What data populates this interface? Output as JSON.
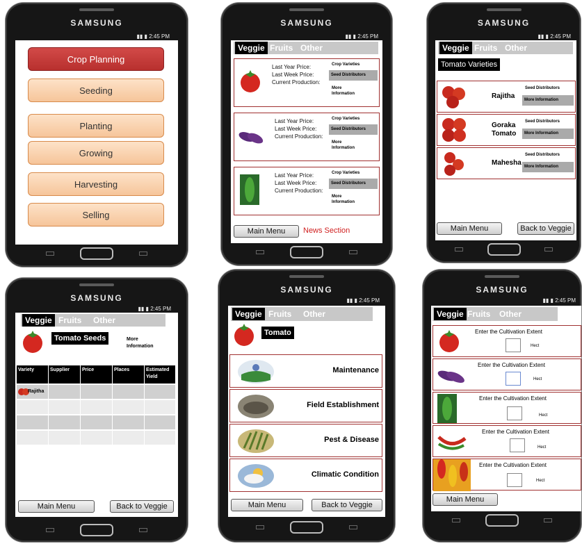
{
  "brand": "SAMSUNG",
  "status_time": "2:45 PM",
  "phone1": {
    "menu": [
      "Crop Planning",
      "Seeding",
      "Planting",
      "Growing",
      "Harvesting",
      "Selling"
    ]
  },
  "tabs": {
    "veggie": "Veggie",
    "fruits": "Fruits",
    "other": "Other"
  },
  "phone2": {
    "cards": [
      {
        "labels": [
          "Last Year Price:",
          "Last Week Price:",
          "Current Production:"
        ],
        "crop_varieties": "Crop Varieties",
        "seed_distributors": "Seed Distributors",
        "more_info": "More Information"
      },
      {
        "labels": [
          "Last Year Price:",
          "Last Week Price:",
          "Current Production:"
        ],
        "crop_varieties": "Crop Varieties",
        "seed_distributors": "Seed Distributors",
        "more_info": "More Information"
      },
      {
        "labels": [
          "Last Year Price:",
          "Last Week Price:",
          "Current Production:"
        ],
        "crop_varieties": "Crop Varieties",
        "seed_distributors": "Seed Distributors",
        "more_info": "More Information"
      }
    ],
    "main_menu": "Main Menu",
    "news_section": "News Section"
  },
  "phone3": {
    "header": "Tomato Varieties",
    "varieties": [
      {
        "name": "Rajitha",
        "seed": "Seed Distributors",
        "more": "More Information"
      },
      {
        "name": "Goraka Tomato",
        "seed": "Seed Distributors",
        "more": "More Information"
      },
      {
        "name": "Mahesha",
        "seed": "Seed Distributors",
        "more": "More Information"
      }
    ],
    "main_menu": "Main Menu",
    "back": "Back to Veggie"
  },
  "phone4": {
    "header": "Tomato Seeds",
    "more": "More Information",
    "columns": [
      "Variety",
      "Supplier",
      "Price",
      "Places",
      "Estimated Yield"
    ],
    "rows": [
      [
        "Rajitha",
        "",
        "",
        "",
        ""
      ],
      [
        "",
        "",
        "",
        "",
        ""
      ],
      [
        "",
        "",
        "",
        "",
        ""
      ],
      [
        "",
        "",
        "",
        "",
        ""
      ]
    ],
    "main_menu": "Main Menu",
    "back": "Back to Veggie"
  },
  "phone5": {
    "header": "Tomato",
    "items": [
      "Maintenance",
      "Field Establishment",
      "Pest & Disease",
      "Climatic Condition"
    ],
    "main_menu": "Main Menu",
    "back": "Back to Veggie"
  },
  "phone6": {
    "rows": [
      {
        "label": "Enter the Cultivation Extent",
        "unit": "Hect"
      },
      {
        "label": "Enter the Cultivation Extent",
        "unit": "Hect"
      },
      {
        "label": "Enter the Cultivation Extent",
        "unit": "Hect"
      },
      {
        "label": "Enter the Cultivation Extent",
        "unit": "Hect"
      },
      {
        "label": "Enter the Cultivation Extent",
        "unit": "Hect"
      }
    ],
    "main_menu": "Main Menu"
  },
  "colors": {
    "accent_red": "#b8302e",
    "menu_orange": "#f6c59a",
    "card_border": "#a03030",
    "news_red": "#d02020"
  }
}
